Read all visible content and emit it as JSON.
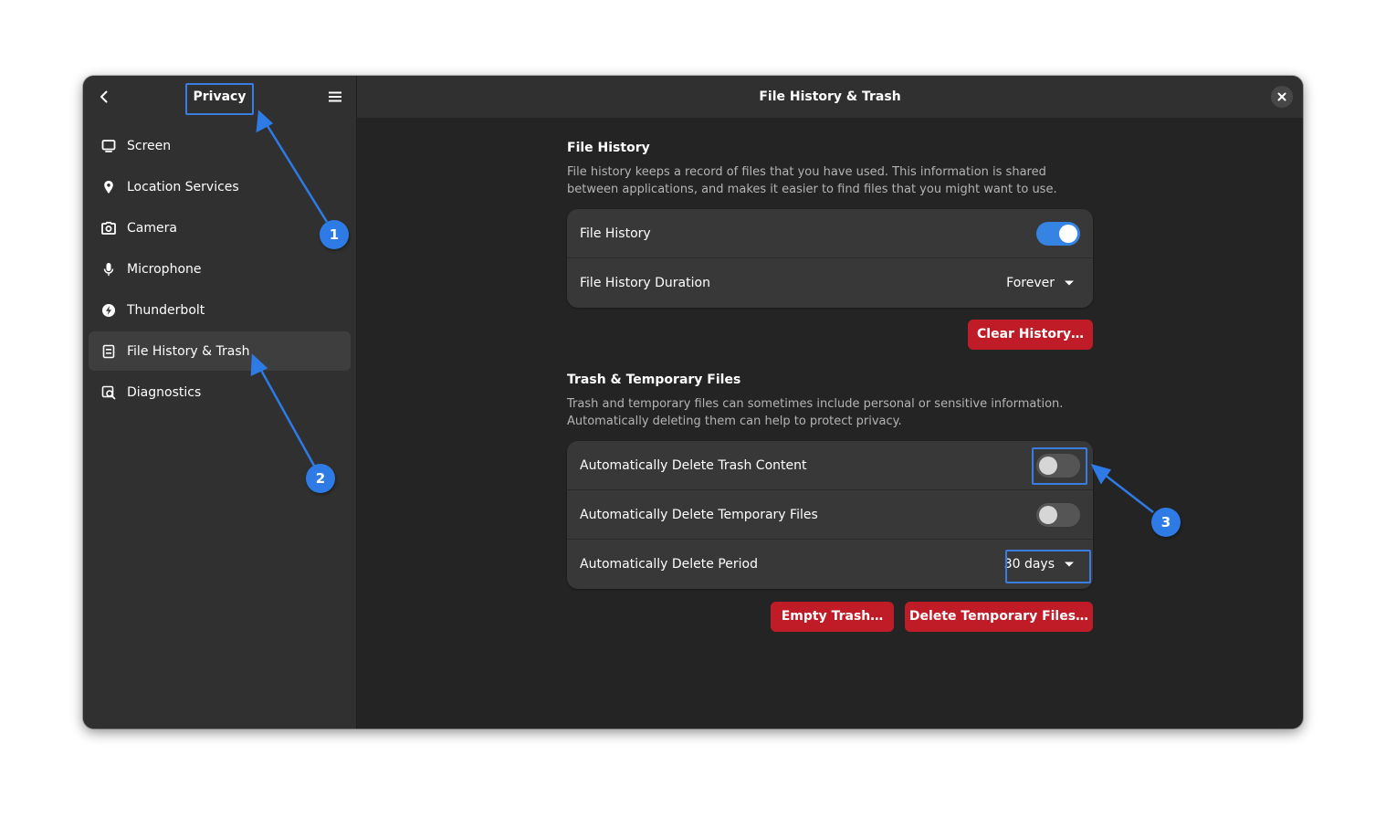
{
  "sidebar": {
    "title": "Privacy",
    "items": [
      {
        "label": "Screen",
        "icon": "display-icon"
      },
      {
        "label": "Location Services",
        "icon": "location-pin-icon"
      },
      {
        "label": "Camera",
        "icon": "camera-icon"
      },
      {
        "label": "Microphone",
        "icon": "microphone-icon"
      },
      {
        "label": "Thunderbolt",
        "icon": "thunderbolt-icon"
      },
      {
        "label": "File History & Trash",
        "icon": "file-history-icon",
        "active": true
      },
      {
        "label": "Diagnostics",
        "icon": "diagnostics-icon"
      }
    ]
  },
  "header": {
    "title": "File History & Trash"
  },
  "file_history": {
    "title": "File History",
    "description": "File history keeps a record of files that you have used. This information is shared between applications, and makes it easier to find files that you might want to use.",
    "toggle_label": "File History",
    "toggle_on": true,
    "duration_label": "File History Duration",
    "duration_value": "Forever",
    "clear_button": "Clear History…"
  },
  "trash": {
    "title": "Trash & Temporary Files",
    "description": "Trash and temporary files can sometimes include personal or sensitive information. Automatically deleting them can help to protect privacy.",
    "auto_trash_label": "Automatically Delete Trash Content",
    "auto_trash_on": false,
    "auto_temp_label": "Automatically Delete Temporary Files",
    "auto_temp_on": false,
    "period_label": "Automatically Delete Period",
    "period_value": "30 days",
    "empty_button": "Empty Trash…",
    "delete_temp_button": "Delete Temporary Files…"
  },
  "annotations": {
    "badge1": "1",
    "badge2": "2",
    "badge3": "3"
  },
  "colors": {
    "accent": "#3584e4",
    "destructive": "#c01c28",
    "annotation": "#2e7be6"
  }
}
